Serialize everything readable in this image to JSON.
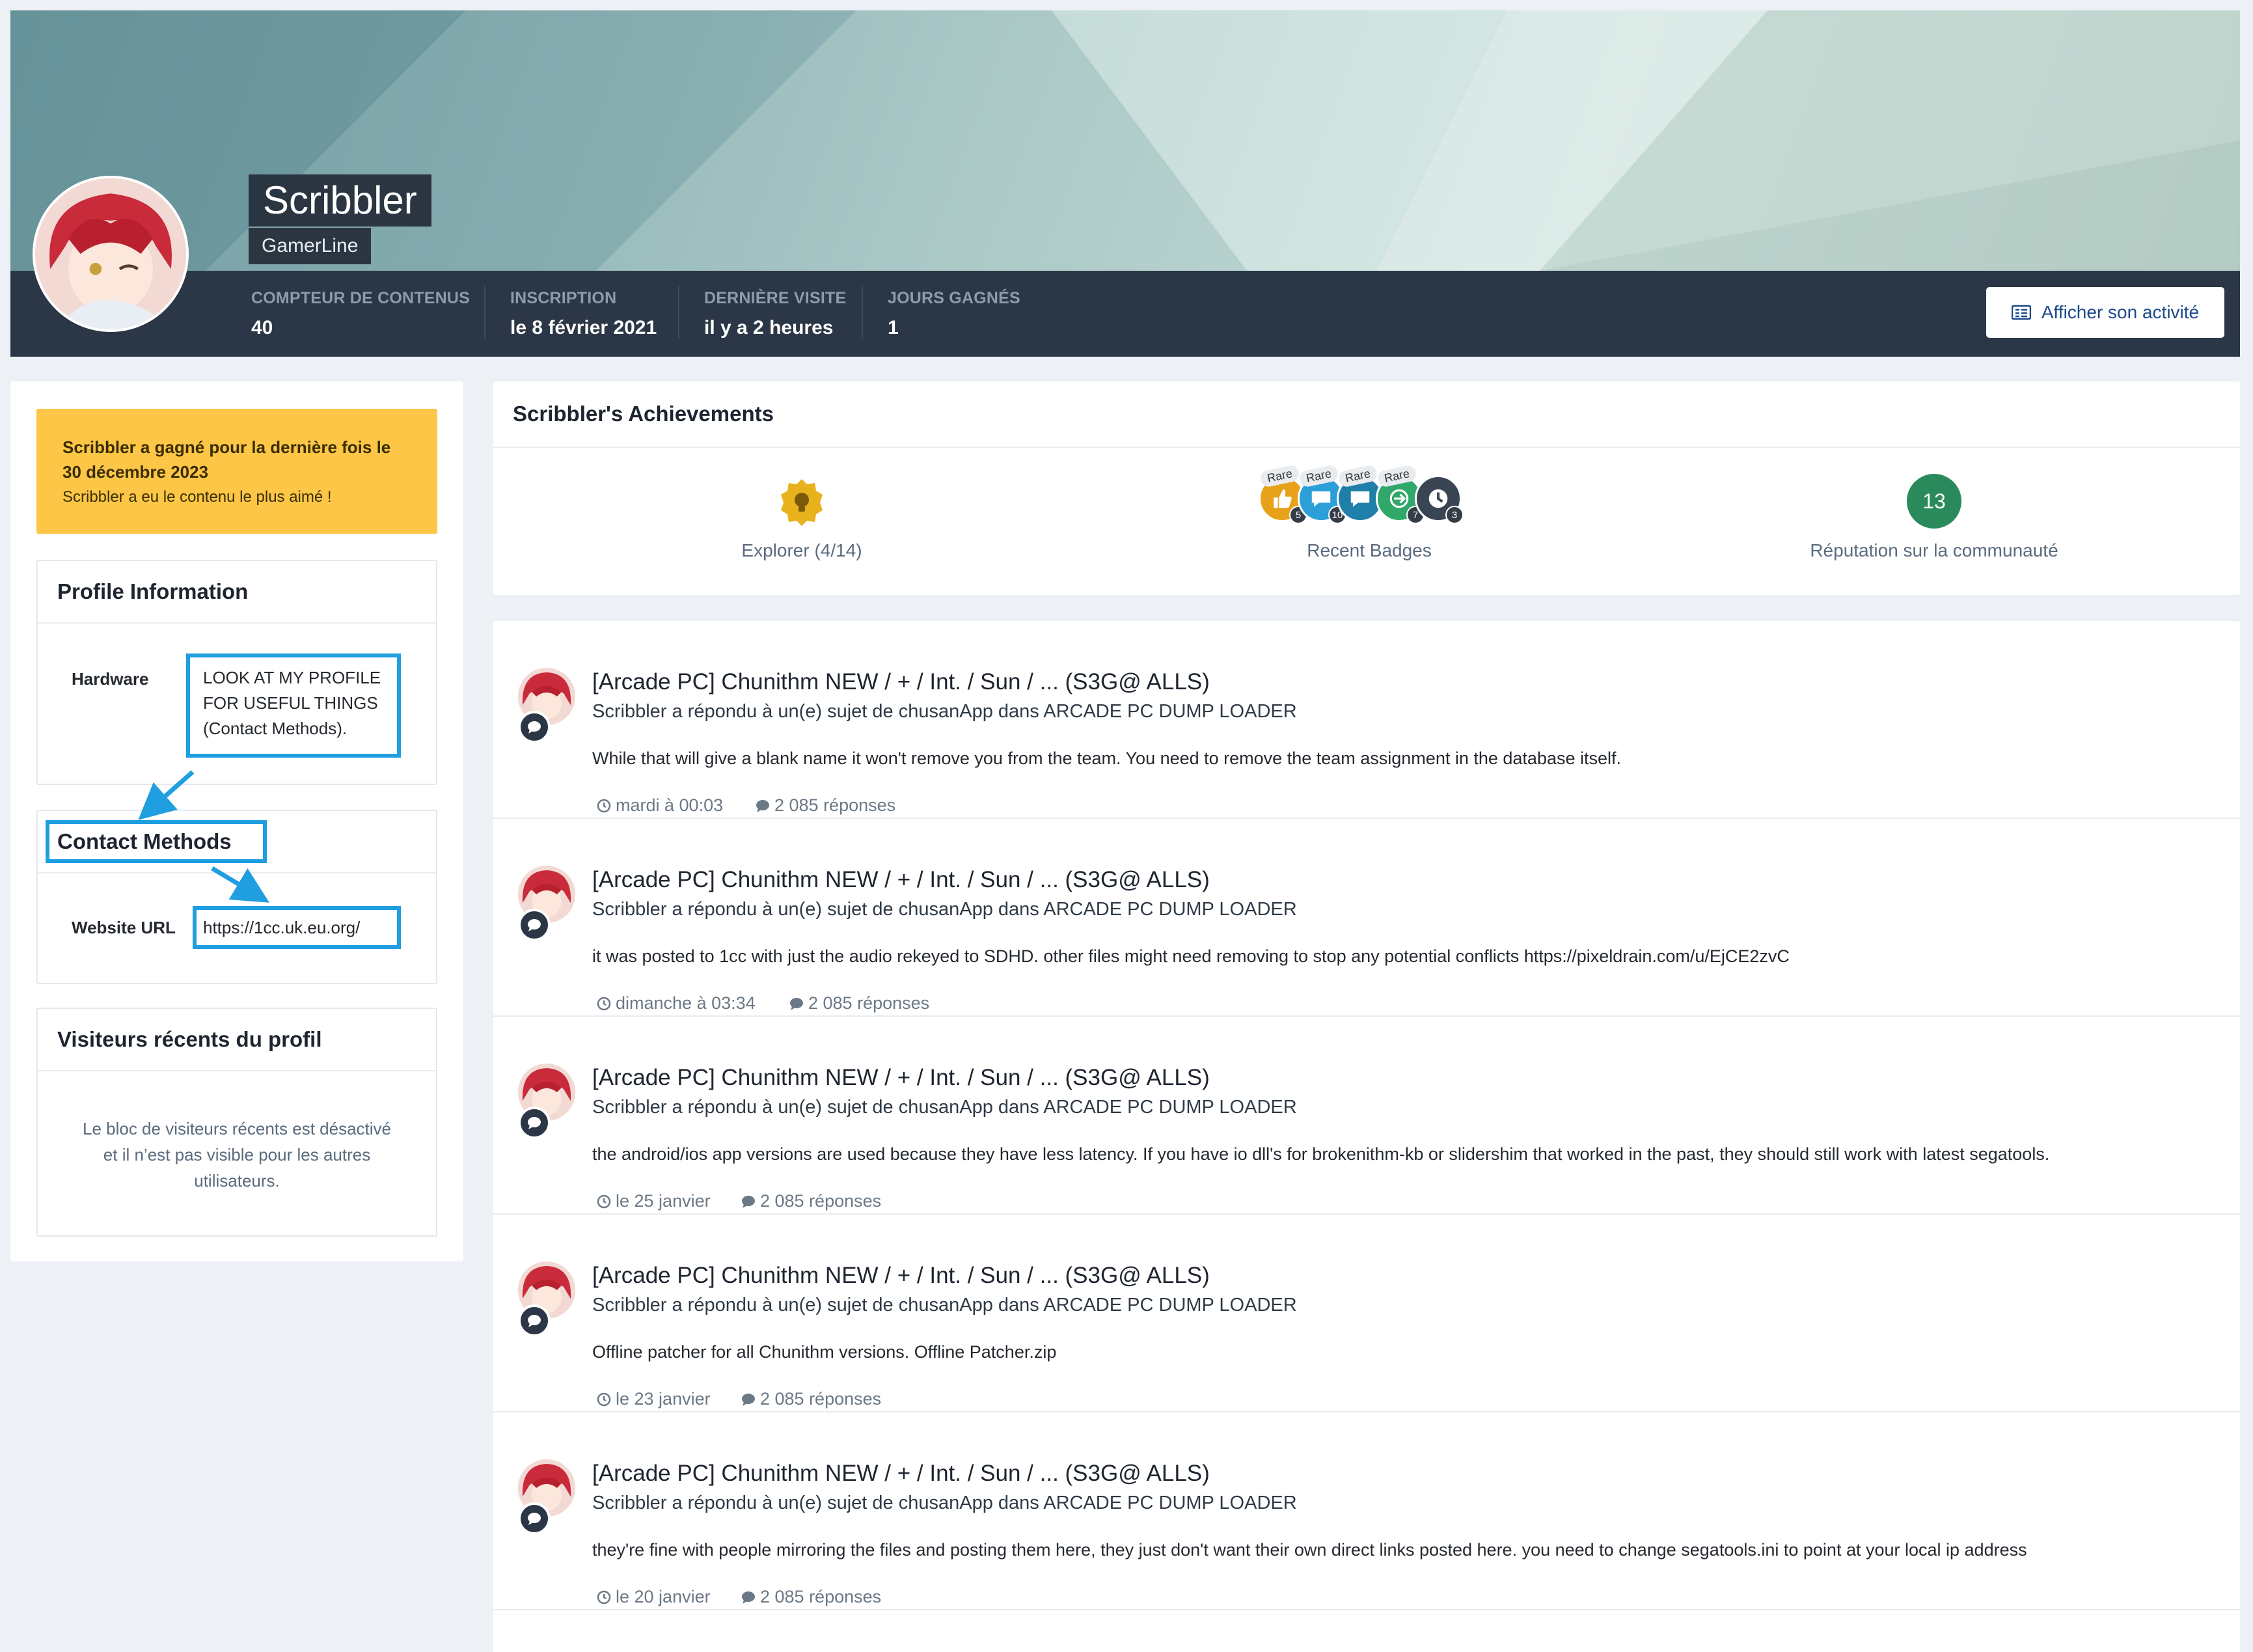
{
  "profile": {
    "username": "Scribbler",
    "group": "GamerLine",
    "stats": [
      {
        "label": "COMPTEUR DE CONTENUS",
        "value": "40"
      },
      {
        "label": "INSCRIPTION",
        "value": "le 8 février 2021"
      },
      {
        "label": "DERNIÈRE VISITE",
        "value": "il y a 2 heures"
      },
      {
        "label": "JOURS GAGNÉS",
        "value": "1"
      }
    ],
    "activity_button": "Afficher son activité"
  },
  "sidebar": {
    "won": {
      "title": "Scribbler a gagné pour la dernière fois le 30 décembre 2023",
      "subtitle": "Scribbler a eu le contenu le plus aimé !"
    },
    "profile_info": {
      "title": "Profile Information",
      "hardware_label": "Hardware",
      "hardware_lines": [
        "LOOK AT MY PROFILE",
        "FOR USEFUL THINGS",
        "(Contact Methods)."
      ]
    },
    "contact": {
      "title": "Contact Methods",
      "website_label": "Website URL",
      "website_value": "https://1cc.uk.eu.org/"
    },
    "visitors": {
      "title": "Visiteurs récents du profil",
      "lines": [
        "Le bloc de visiteurs récents est désactivé",
        "et il n’est pas visible pour les autres",
        "utilisateurs."
      ]
    }
  },
  "achievements": {
    "title": "Scribbler's Achievements",
    "explorer_label": "Explorer (4/14)",
    "recent_badges_label": "Recent Badges",
    "reputation_value": "13",
    "reputation_label": "Réputation sur la communauté",
    "badges": [
      {
        "rare": "Rare",
        "count": "5",
        "color": "#e8a21a",
        "icon": "thumbs-up-icon"
      },
      {
        "rare": "Rare",
        "count": "10",
        "color": "#2a9fd8",
        "icon": "chat-icon"
      },
      {
        "rare": "Rare",
        "count": "",
        "color": "#1f7fa8",
        "icon": "chat-icon"
      },
      {
        "rare": "Rare",
        "count": "7",
        "color": "#2fa86a",
        "icon": "sign-in-icon"
      },
      {
        "rare": "",
        "count": "3",
        "color": "#3a4553",
        "icon": "clock-icon"
      }
    ],
    "colors": {
      "explorer": "#e8b21c",
      "reputation": "#2a8a5c"
    }
  },
  "feed": [
    {
      "title": "[Arcade PC] Chunithm NEW / + / Int. / Sun / ... (S3G@ ALLS)",
      "subtitle": "Scribbler a répondu à un(e) sujet de chusanApp dans ARCADE PC DUMP LOADER",
      "body": "While that will give a blank name it won't remove you from the team. You need to remove the team assignment in the database itself.",
      "date": "mardi à 00:03",
      "replies": "2 085 réponses"
    },
    {
      "title": "[Arcade PC] Chunithm NEW / + / Int. / Sun / ... (S3G@ ALLS)",
      "subtitle": "Scribbler a répondu à un(e) sujet de chusanApp dans ARCADE PC DUMP LOADER",
      "body": "it was posted to 1cc with just the audio rekeyed to SDHD. other files might need removing to stop any potential conflicts https://pixeldrain.com/u/EjCE2zvC",
      "date": "dimanche à 03:34",
      "replies": "2 085 réponses"
    },
    {
      "title": "[Arcade PC] Chunithm NEW / + / Int. / Sun / ... (S3G@ ALLS)",
      "subtitle": "Scribbler a répondu à un(e) sujet de chusanApp dans ARCADE PC DUMP LOADER",
      "body": "the android/ios app versions are used because they have less latency. If you have io dll's for brokenithm-kb or slidershim that worked in the past, they should still work with latest segatools.",
      "date": "le 25 janvier",
      "replies": "2 085 réponses"
    },
    {
      "title": "[Arcade PC] Chunithm NEW / + / Int. / Sun / ... (S3G@ ALLS)",
      "subtitle": "Scribbler a répondu à un(e) sujet de chusanApp dans ARCADE PC DUMP LOADER",
      "body": "Offline patcher for all Chunithm versions. Offline Patcher.zip",
      "date": "le 23 janvier",
      "replies": "2 085 réponses"
    },
    {
      "title": "[Arcade PC] Chunithm NEW / + / Int. / Sun / ... (S3G@ ALLS)",
      "subtitle": "Scribbler a répondu à un(e) sujet de chusanApp dans ARCADE PC DUMP LOADER",
      "body": "they're fine with people mirroring the files and posting them here, they just don't want their own direct links posted here. you need to change segatools.ini to point at your local ip address",
      "date": "le 20 janvier",
      "replies": "2 085 réponses"
    }
  ]
}
